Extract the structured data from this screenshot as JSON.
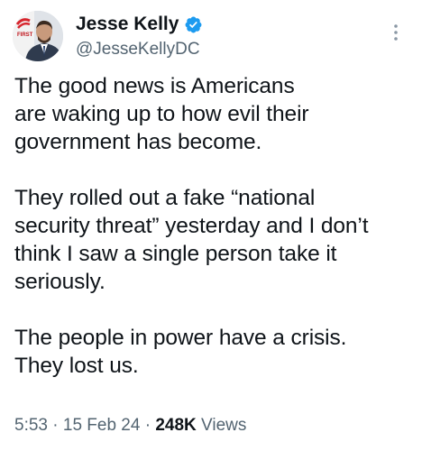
{
  "author": {
    "display_name": "Jesse Kelly",
    "handle": "@JesseKellyDC",
    "avatar_badge_text": "FIRST",
    "verified": true
  },
  "tweet": {
    "paragraphs": [
      [
        "The good news is Americans",
        "are waking up to how evil their",
        "government has become."
      ],
      [
        "They rolled out a fake “national",
        "security threat” yesterday and I don’t",
        "think I saw a single person take it",
        "seriously."
      ],
      [
        "The people in power have a crisis.",
        "They lost us."
      ]
    ]
  },
  "meta": {
    "time": "5:53",
    "separator": "·",
    "date": "15 Feb 24",
    "views_count": "248K",
    "views_label": "Views"
  },
  "colors": {
    "text": "#0f1419",
    "secondary": "#536471",
    "verified_blue": "#1d9bf0"
  },
  "icons": {
    "verified": "verified-badge-icon",
    "more": "more-vertical-icon"
  }
}
